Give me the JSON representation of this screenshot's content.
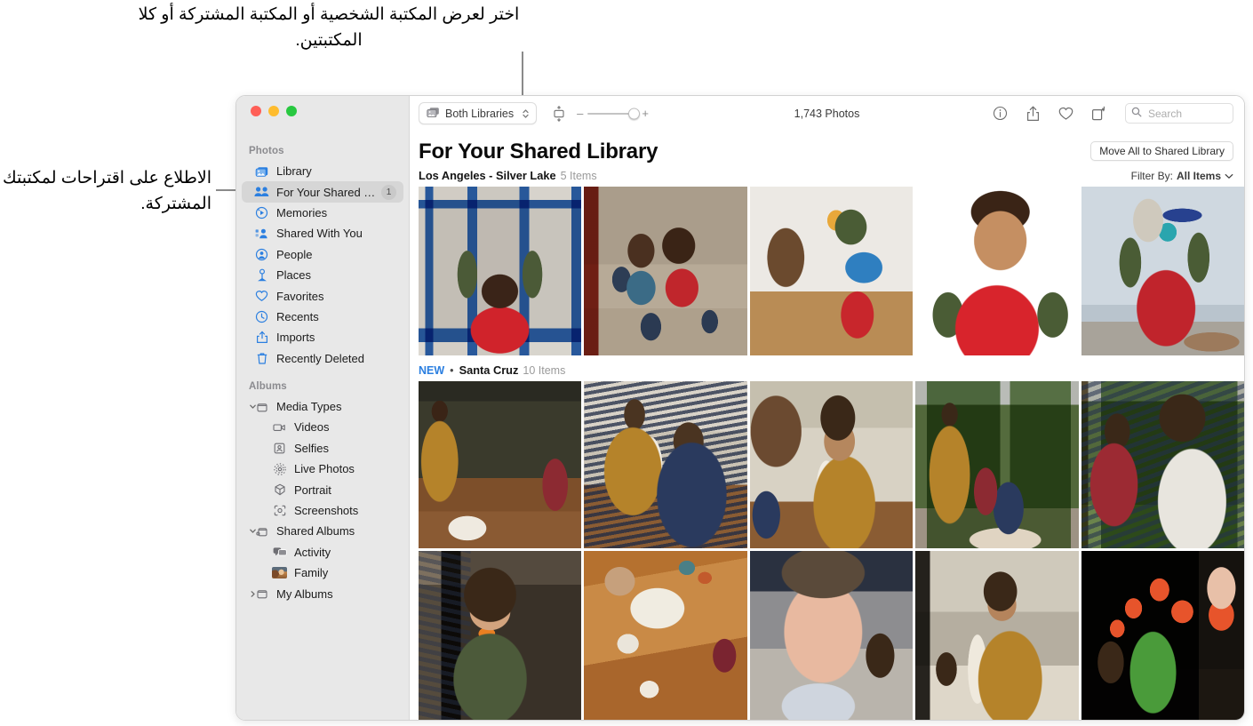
{
  "callouts": {
    "top": "اختر لعرض المكتبة الشخصية أو المكتبة المشتركة أو كلا المكتبتين.",
    "left": "الاطلاع على اقتراحات لمكتبتك المشتركة."
  },
  "window": {
    "traffic_lights": [
      "close-red",
      "minimize-yellow",
      "zoom-green"
    ]
  },
  "sidebar": {
    "sections": [
      {
        "header": "Photos",
        "items": [
          {
            "label": "Library",
            "icon": "library-icon",
            "selected": false,
            "badge": ""
          },
          {
            "label": "For Your Shared Library",
            "icon": "shared-library-icon",
            "selected": true,
            "badge": "1"
          },
          {
            "label": "Memories",
            "icon": "memories-icon",
            "selected": false,
            "badge": ""
          },
          {
            "label": "Shared With You",
            "icon": "shared-with-you-icon",
            "selected": false,
            "badge": ""
          },
          {
            "label": "People",
            "icon": "people-icon",
            "selected": false,
            "badge": ""
          },
          {
            "label": "Places",
            "icon": "places-icon",
            "selected": false,
            "badge": ""
          },
          {
            "label": "Favorites",
            "icon": "heart-icon",
            "selected": false,
            "badge": ""
          },
          {
            "label": "Recents",
            "icon": "clock-icon",
            "selected": false,
            "badge": ""
          },
          {
            "label": "Imports",
            "icon": "import-icon",
            "selected": false,
            "badge": ""
          },
          {
            "label": "Recently Deleted",
            "icon": "trash-icon",
            "selected": false,
            "badge": ""
          }
        ]
      },
      {
        "header": "Albums",
        "items": [
          {
            "label": "Media Types",
            "icon": "folder-icon",
            "disclosure": "expanded",
            "child": false
          },
          {
            "label": "Videos",
            "icon": "video-icon",
            "child": true
          },
          {
            "label": "Selfies",
            "icon": "selfie-icon",
            "child": true
          },
          {
            "label": "Live Photos",
            "icon": "live-photo-icon",
            "child": true
          },
          {
            "label": "Portrait",
            "icon": "portrait-icon",
            "child": true
          },
          {
            "label": "Screenshots",
            "icon": "screenshot-icon",
            "child": true
          },
          {
            "label": "Shared Albums",
            "icon": "shared-folder-icon",
            "disclosure": "expanded",
            "child": false
          },
          {
            "label": "Activity",
            "icon": "activity-icon",
            "child": true
          },
          {
            "label": "Family",
            "icon": "album-thumbnail-icon",
            "child": true
          },
          {
            "label": "My Albums",
            "icon": "folder-icon",
            "disclosure": "collapsed",
            "child": false
          }
        ]
      }
    ]
  },
  "toolbar": {
    "library_picker_label": "Both Libraries",
    "library_picker_icon": "photos-stack-icon",
    "zoom_fit_icon": "aspect-fit-icon",
    "zoom_out_label": "–",
    "zoom_in_label": "+",
    "photo_count": "1,743 Photos",
    "info_icon": "info-icon",
    "share_icon": "share-icon",
    "favorite_icon": "heart-icon",
    "rotate_icon": "rotate-icon",
    "search_placeholder": "Search",
    "search_value": "",
    "search_icon": "search-icon"
  },
  "main": {
    "page_title": "For Your Shared Library",
    "move_all_label": "Move All to Shared Library",
    "filter_prefix": "Filter By:",
    "filter_value": "All Items",
    "filter_chevron": "chevron-down-icon",
    "sections": [
      {
        "new_tag": "",
        "separator_dot": "",
        "name": "Los Angeles - Silver Lake",
        "count": "5 Items",
        "rows": [
          [
            {
              "name": "child-at-blue-window"
            },
            {
              "name": "two-children-on-bed"
            },
            {
              "name": "child-with-guitar"
            },
            {
              "name": "smiling-child-orange-tree"
            },
            {
              "name": "child-with-megaphone"
            }
          ]
        ]
      },
      {
        "new_tag": "NEW",
        "separator_dot": "•",
        "name": "Santa Cruz",
        "count": "10 Items",
        "rows": [
          [
            {
              "name": "kitchen-baking-wide"
            },
            {
              "name": "mother-and-child-baking"
            },
            {
              "name": "mother-laughing-flour"
            },
            {
              "name": "family-at-window"
            },
            {
              "name": "two-children-window"
            }
          ],
          [
            {
              "name": "child-eating-orange"
            },
            {
              "name": "hands-kneading-dough"
            },
            {
              "name": "child-floury-face"
            },
            {
              "name": "mother-smiling-towel"
            },
            {
              "name": "baby-with-tulips"
            }
          ]
        ]
      }
    ]
  },
  "colors": {
    "accent_blue": "#2b7fe0",
    "sidebar_bg": "#e8e8e8",
    "selected_row": "#d6d6d6",
    "traffic_red": "#ff5f57",
    "traffic_yellow": "#febc2e",
    "traffic_green": "#28c840"
  }
}
